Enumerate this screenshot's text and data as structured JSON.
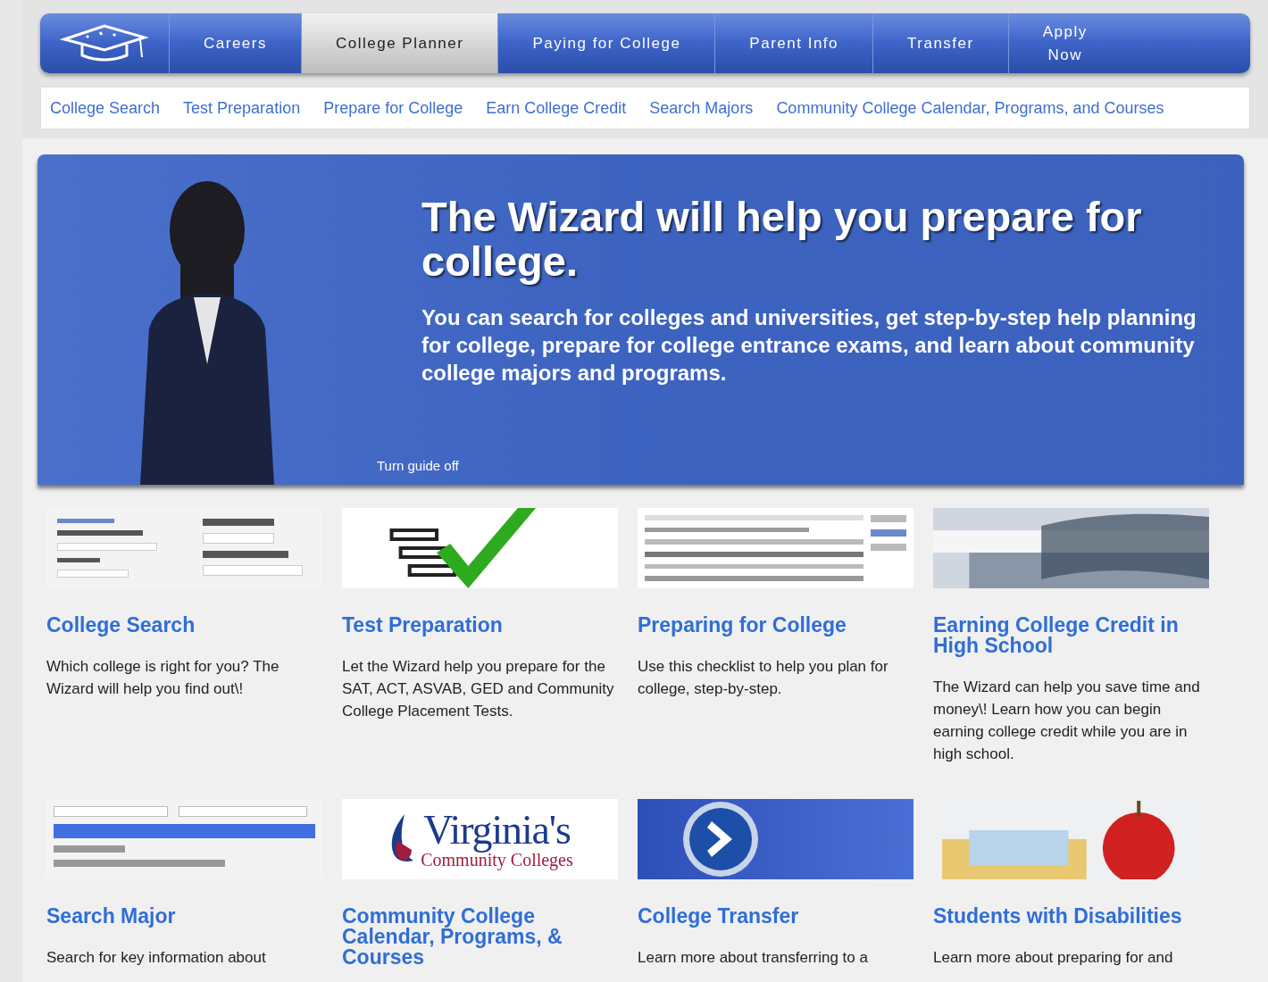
{
  "nav": {
    "tabs": [
      {
        "label": "Careers",
        "selected": false
      },
      {
        "label": "College Planner",
        "selected": true
      },
      {
        "label": "Paying for College",
        "selected": false
      },
      {
        "label": "Parent Info",
        "selected": false
      },
      {
        "label": "Transfer",
        "selected": false
      },
      {
        "label": "Apply Now",
        "selected": false
      }
    ]
  },
  "subnav": [
    "College Search",
    "Test Preparation",
    "Prepare for College",
    "Earn College Credit",
    "Search Majors",
    "Community College Calendar, Programs, and Courses"
  ],
  "hero": {
    "title": "The Wizard will help you prepare for college.",
    "text": "You can search for colleges and universities, get step-by-step help planning for college, prepare for college entrance exams, and learn about community college majors and programs.",
    "guide_link": "Turn guide off"
  },
  "cards": [
    {
      "kind": "form",
      "title": "College Search",
      "text": "Which college is right for you? The Wizard will help you find out\\!"
    },
    {
      "kind": "checklist",
      "title": "Test Preparation",
      "text": "Let the Wizard help you prepare for the SAT, ACT, ASVAB, GED and Community College Placement Tests."
    },
    {
      "kind": "document",
      "title": "Preparing for College",
      "text": "Use this checklist to help you plan for college, step-by-step."
    },
    {
      "kind": "books",
      "title": "Earning College Credit in High School",
      "text": "The Wizard can help you save time and money\\! Learn how you can begin earning college credit while you are in high school."
    },
    {
      "kind": "list",
      "title": "Search Major",
      "text": "Search for key information about"
    },
    {
      "kind": "logo",
      "title": "Community College Calendar, Programs, & Courses",
      "logo": {
        "name": "Virginia's",
        "subtitle": "Community Colleges"
      }
    },
    {
      "kind": "arrow",
      "title": "College Transfer",
      "text": "Learn more about transferring to a"
    },
    {
      "kind": "apple",
      "title": "Students with Disabilities",
      "text": "Learn more about preparing for and"
    }
  ]
}
